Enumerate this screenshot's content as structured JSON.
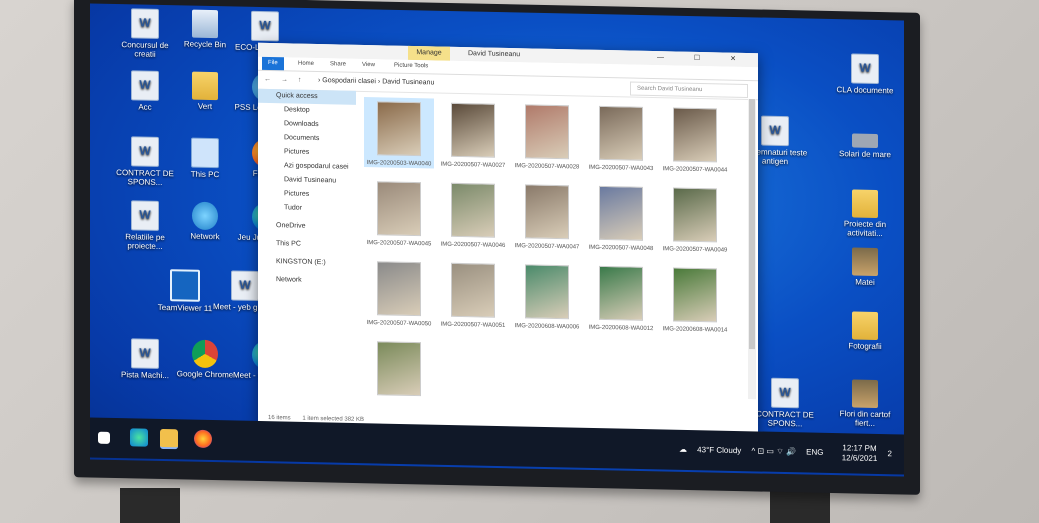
{
  "desktop_left": [
    {
      "label": "Concursul de creatii",
      "icon": "document-icon"
    },
    {
      "label": "Recycle Bin",
      "icon": "recycle-bin-icon"
    },
    {
      "label": "ECO-LOGIC doc",
      "icon": "document-icon"
    },
    {
      "label": "Acc",
      "icon": "document-icon"
    },
    {
      "label": "Vert",
      "icon": "folder-icon"
    },
    {
      "label": "PSS Lowe FREE",
      "icon": "app-icon"
    },
    {
      "label": "CONTRACT DE SPONS...",
      "icon": "document-icon"
    },
    {
      "label": "This PC",
      "icon": "computer-icon"
    },
    {
      "label": "Firefox",
      "icon": "firefox-icon"
    },
    {
      "label": "Relatiile pe proiecte...",
      "icon": "document-icon"
    },
    {
      "label": "Network",
      "icon": "network-icon"
    },
    {
      "label": "Jeu Junior Plus",
      "icon": "edge-icon"
    },
    {
      "label": "TeamViewer 11",
      "icon": "teamviewer-icon"
    },
    {
      "label": "Meet - yeb guqk...",
      "icon": "document-icon"
    },
    {
      "label": "Pista Machi...",
      "icon": "document-icon"
    },
    {
      "label": "Google Chrome",
      "icon": "chrome-icon"
    },
    {
      "label": "Meet - yeb guqk...",
      "icon": "edge-icon"
    }
  ],
  "desktop_right": [
    {
      "label": "CLA documente",
      "icon": "document-icon"
    },
    {
      "label": "Solari de mare",
      "icon": "drive-icon"
    },
    {
      "label": "Proiecte din activitati...",
      "icon": "folder-icon"
    },
    {
      "label": "Matei",
      "icon": "image-icon"
    },
    {
      "label": "Fotografii",
      "icon": "folder-icon"
    },
    {
      "label": "Flori din cartof fiert...",
      "icon": "image-icon"
    },
    {
      "label": "IV semnaturi teste antigen",
      "icon": "document-icon"
    },
    {
      "label": "CONTRACT DE SPONS...",
      "icon": "document-icon"
    }
  ],
  "explorer": {
    "manage_tab": "Manage",
    "title": "David Tusineanu",
    "window_controls": "— ☐ ✕",
    "ribbon_tabs": [
      "File",
      "Home",
      "Share",
      "View",
      "Picture Tools"
    ],
    "nav_buttons": "← → ↑",
    "breadcrumb": "›  Gospodarii clasei  ›  David Tusineanu",
    "search_placeholder": "Search David Tusineanu",
    "nav_items": [
      {
        "label": "Quick access",
        "selected": true
      },
      {
        "label": "Desktop"
      },
      {
        "label": "Downloads"
      },
      {
        "label": "Documents"
      },
      {
        "label": "Pictures"
      },
      {
        "label": "Azi gospodarul casei"
      },
      {
        "label": "David Tusineanu"
      },
      {
        "label": "Pictures"
      },
      {
        "label": "Tudor"
      },
      {
        "label": "OneDrive"
      },
      {
        "label": "This PC"
      },
      {
        "label": "KINGSTON (E:)"
      },
      {
        "label": "Network"
      }
    ],
    "files": [
      {
        "name": "IMG-20200503-WA0040",
        "selected": true
      },
      {
        "name": "IMG-20200507-WA0027"
      },
      {
        "name": "IMG-20200507-WA0028"
      },
      {
        "name": "IMG-20200507-WA0043"
      },
      {
        "name": "IMG-20200507-WA0044"
      },
      {
        "name": "IMG-20200507-WA0045"
      },
      {
        "name": "IMG-20200507-WA0046"
      },
      {
        "name": "IMG-20200507-WA0047"
      },
      {
        "name": "IMG-20200507-WA0048"
      },
      {
        "name": "IMG-20200507-WA0049"
      },
      {
        "name": "IMG-20200507-WA0050"
      },
      {
        "name": "IMG-20200507-WA0051"
      },
      {
        "name": "IMG-20200608-WA0006"
      },
      {
        "name": "IMG-20200608-WA0012"
      },
      {
        "name": "IMG-20200608-WA0014"
      },
      {
        "name": ""
      }
    ],
    "status_count": "16 items",
    "status_selected": "1 item selected  382 KB"
  },
  "taskbar": {
    "weather": "43°F  Cloudy",
    "tray_icons": "^  ⊡  ▭  ⌔  🔊",
    "language": "ENG",
    "time": "12:17 PM",
    "date": "12/6/2021",
    "notifications": "2"
  }
}
